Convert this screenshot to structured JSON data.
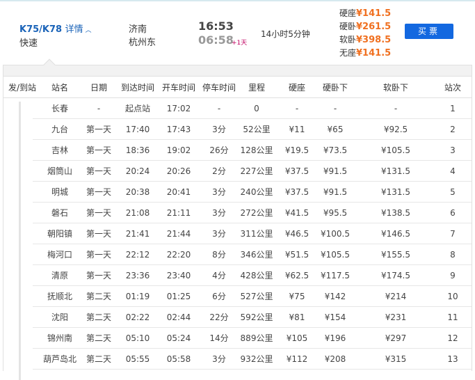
{
  "train": {
    "number": "K75/K78",
    "detail_label": "详情",
    "type": "快速",
    "from": "济南",
    "to": "杭州东",
    "depart": "16:53",
    "arrive": "06:58",
    "day_offset": "+1天",
    "duration": "14小时5分钟",
    "buy_label": "买票",
    "prices": [
      {
        "seat": "硬座",
        "price": "¥141.5"
      },
      {
        "seat": "硬卧",
        "price": "¥261.5"
      },
      {
        "seat": "软卧",
        "price": "¥398.5"
      },
      {
        "seat": "无座",
        "price": "¥141.5"
      }
    ]
  },
  "colors": {
    "accent": "#1368e0",
    "price": "#f07020",
    "link": "#1a63b8"
  },
  "table": {
    "headers": [
      "发/到站",
      "站名",
      "日期",
      "到达时间",
      "开车时间",
      "停车时间",
      "里程",
      "硬座",
      "硬卧下",
      "软卧下",
      "站次"
    ],
    "rows": [
      [
        "长春",
        "-",
        "起点站",
        "17:02",
        "-",
        "0",
        "-",
        "-",
        "-",
        "1"
      ],
      [
        "九台",
        "第一天",
        "17:40",
        "17:43",
        "3分",
        "52公里",
        "¥11",
        "¥65",
        "¥92.5",
        "2"
      ],
      [
        "吉林",
        "第一天",
        "18:36",
        "19:02",
        "26分",
        "128公里",
        "¥19.5",
        "¥73.5",
        "¥105.5",
        "3"
      ],
      [
        "烟筒山",
        "第一天",
        "20:24",
        "20:26",
        "2分",
        "227公里",
        "¥37.5",
        "¥91.5",
        "¥131.5",
        "4"
      ],
      [
        "明城",
        "第一天",
        "20:38",
        "20:41",
        "3分",
        "240公里",
        "¥37.5",
        "¥91.5",
        "¥131.5",
        "5"
      ],
      [
        "磐石",
        "第一天",
        "21:08",
        "21:11",
        "3分",
        "272公里",
        "¥41.5",
        "¥95.5",
        "¥138.5",
        "6"
      ],
      [
        "朝阳镇",
        "第一天",
        "21:41",
        "21:44",
        "3分",
        "311公里",
        "¥46.5",
        "¥100.5",
        "¥146.5",
        "7"
      ],
      [
        "梅河口",
        "第一天",
        "22:12",
        "22:20",
        "8分",
        "346公里",
        "¥51.5",
        "¥105.5",
        "¥155.5",
        "8"
      ],
      [
        "清原",
        "第一天",
        "23:36",
        "23:40",
        "4分",
        "428公里",
        "¥62.5",
        "¥117.5",
        "¥174.5",
        "9"
      ],
      [
        "抚顺北",
        "第二天",
        "01:19",
        "01:25",
        "6分",
        "527公里",
        "¥75",
        "¥142",
        "¥214",
        "10"
      ],
      [
        "沈阳",
        "第二天",
        "02:22",
        "02:44",
        "22分",
        "592公里",
        "¥81",
        "¥154",
        "¥231",
        "11"
      ],
      [
        "锦州南",
        "第二天",
        "05:10",
        "05:24",
        "14分",
        "889公里",
        "¥105",
        "¥196",
        "¥297",
        "12"
      ],
      [
        "葫芦岛北",
        "第二天",
        "05:55",
        "05:58",
        "3分",
        "932公里",
        "¥112",
        "¥208",
        "¥315",
        "13"
      ]
    ]
  }
}
